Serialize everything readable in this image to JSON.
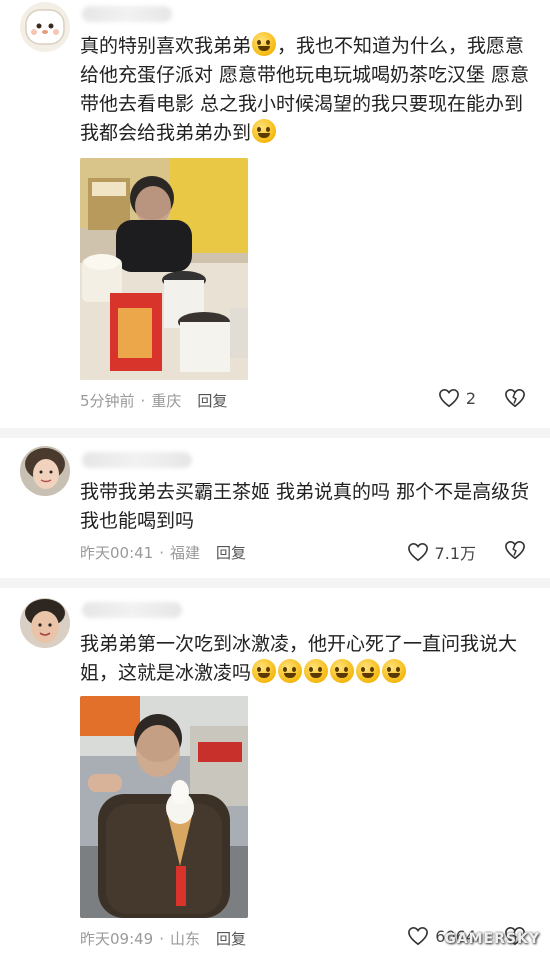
{
  "comments": [
    {
      "text_parts": [
        "真的特别喜欢我弟弟",
        "，我也不知道为什么，我愿意给他充蛋仔派对 愿意带他玩电玩城喝奶茶吃汉堡 愿意带他去看电影 总之我小时候渴望的我只要现在能办到我都会给我弟弟办到"
      ],
      "time": "5分钟前",
      "location": "重庆",
      "reply_label": "回复",
      "likes": "2"
    },
    {
      "text": "我带我弟去买霸王茶姬 我弟说真的吗 那个不是高级货 我也能喝到吗",
      "time": "昨天00:41",
      "location": "福建",
      "reply_label": "回复",
      "likes": "7.1万"
    },
    {
      "text": "我弟弟第一次吃到冰激凌，他开心死了一直问我说大姐，这就是冰激凌吗",
      "time": "昨天09:49",
      "location": "山东",
      "reply_label": "回复",
      "likes": "6064"
    }
  ],
  "watermark": "GAMERSKY"
}
